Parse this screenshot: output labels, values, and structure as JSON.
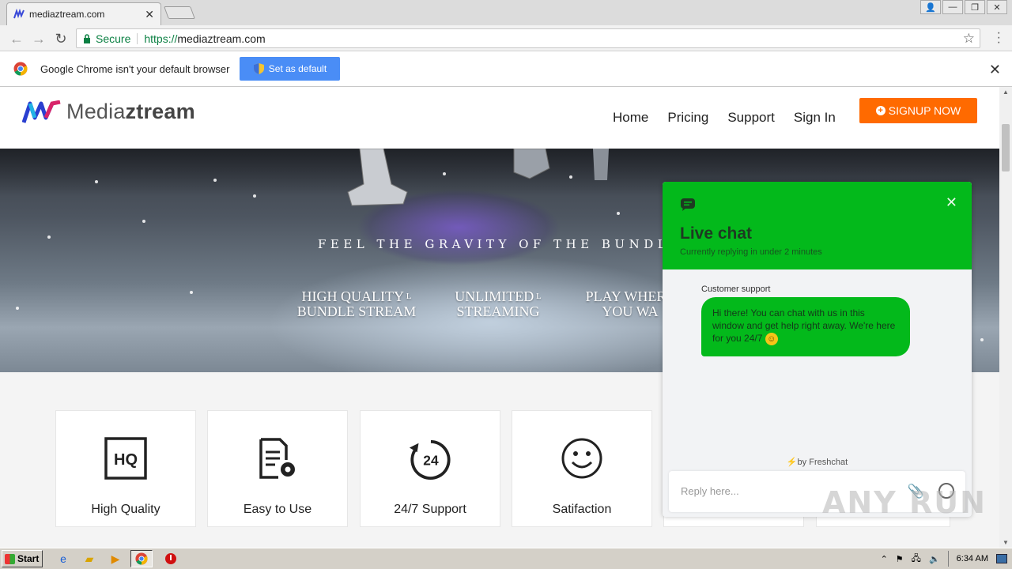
{
  "browser": {
    "tab_title": "mediaztream.com",
    "secure_label": "Secure",
    "url_scheme": "https://",
    "url_host": "mediaztream.com"
  },
  "infobar": {
    "message": "Google Chrome isn't your default browser",
    "button_label": "Set as default"
  },
  "site": {
    "logo_prefix": "Media",
    "logo_bold": "ztream",
    "nav": [
      "Home",
      "Pricing",
      "Support",
      "Sign In"
    ],
    "signup_label": "SIGNUP NOW",
    "hero_tagline": "FEEL THE GRAVITY OF THE BUNDLE",
    "hero_features": [
      {
        "line1": "HIGH QUALITY",
        "line2": "BUNDLE STREAM"
      },
      {
        "line1": "UNLIMITED",
        "line2": "STREAMING"
      },
      {
        "line1": "PLAY WHERE",
        "line2": "YOU WA"
      }
    ],
    "cards": [
      {
        "label": "High Quality",
        "icon": "hq-icon"
      },
      {
        "label": "Easy to Use",
        "icon": "document-gear-icon"
      },
      {
        "label": "24/7 Support",
        "icon": "support-24-icon"
      },
      {
        "label": "Satifaction",
        "icon": "smiley-icon"
      }
    ]
  },
  "chat": {
    "title": "Live chat",
    "subtitle": "Currently replying in under 2 minutes",
    "agent": "Customer support",
    "message": "Hi there! You can chat with us in this window and get help right away. We're here for you 24/7",
    "powered_by": "by Freshchat",
    "reply_placeholder": "Reply here..."
  },
  "taskbar": {
    "start_label": "Start",
    "clock": "6:34 AM"
  },
  "watermark": "ANY RUN",
  "colors": {
    "accent_orange": "#ff6a00",
    "chat_green": "#03b91b",
    "chrome_blue": "#4a8df6"
  }
}
